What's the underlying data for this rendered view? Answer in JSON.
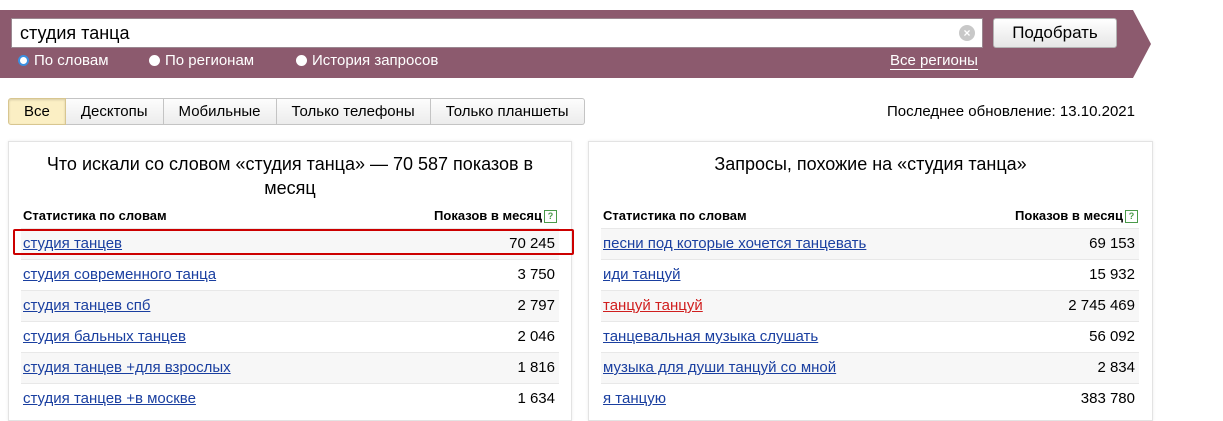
{
  "search": {
    "value": "студия танца",
    "clear_glyph": "×",
    "submit_label": "Подобрать",
    "modes": [
      {
        "label": "По словам",
        "selected": true
      },
      {
        "label": "По регионам",
        "selected": false
      },
      {
        "label": "История запросов",
        "selected": false
      }
    ],
    "regions_link": "Все регионы",
    "header_color": "#8c5a6e"
  },
  "tabs": [
    {
      "label": "Все",
      "active": true
    },
    {
      "label": "Десктопы",
      "active": false
    },
    {
      "label": "Мобильные",
      "active": false
    },
    {
      "label": "Только телефоны",
      "active": false
    },
    {
      "label": "Только планшеты",
      "active": false
    }
  ],
  "last_update": "Последнее обновление: 13.10.2021",
  "left_panel": {
    "title": "Что искали со словом «студия танца» — 70 587 показов в месяц",
    "col_words": "Статистика по словам",
    "col_shows": "Показов в месяц",
    "rows": [
      {
        "phrase": "студия танцев",
        "count": "70 245",
        "highlighted": true
      },
      {
        "phrase": "студия современного танца",
        "count": "3 750"
      },
      {
        "phrase": "студия танцев спб",
        "count": "2 797"
      },
      {
        "phrase": "студия бальных танцев",
        "count": "2 046"
      },
      {
        "phrase": "студия танцев +для взрослых",
        "count": "1 816"
      },
      {
        "phrase": "студия танцев +в москве",
        "count": "1 634"
      }
    ]
  },
  "right_panel": {
    "title": "Запросы, похожие на «студия танца»",
    "col_words": "Статистика по словам",
    "col_shows": "Показов в месяц",
    "rows": [
      {
        "phrase": "песни под которые хочется танцевать",
        "count": "69 153"
      },
      {
        "phrase": "иди танцуй",
        "count": "15 932"
      },
      {
        "phrase": "танцуй танцуй",
        "count": "2 745 469",
        "visited": true
      },
      {
        "phrase": "танцевальная музыка слушать",
        "count": "56 092"
      },
      {
        "phrase": "музыка для души танцуй со мной",
        "count": "2 834"
      },
      {
        "phrase": "я танцую",
        "count": "383 780"
      }
    ]
  },
  "colors": {
    "link": "#1a3fa0",
    "visited_link": "#d01e1e",
    "highlight_border": "#cc0000"
  }
}
